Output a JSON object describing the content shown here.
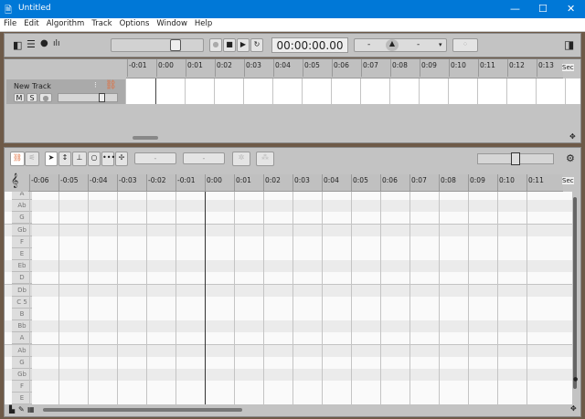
{
  "window": {
    "title": "Untitled",
    "minimize": "—",
    "maximize": "☐",
    "close": "✕"
  },
  "menu": [
    "File",
    "Edit",
    "Algorithm",
    "Track",
    "Options",
    "Window",
    "Help"
  ],
  "toolbar": {
    "time": "00:00:00.00",
    "pitch_left": "-",
    "pitch_right": "-"
  },
  "track": {
    "name": "New Track",
    "mute": "M",
    "solo": "S",
    "volume": 0.75
  },
  "top_ruler": {
    "ticks": [
      "-0:01",
      "0:00",
      "0:01",
      "0:02",
      "0:03",
      "0:04",
      "0:05",
      "0:06",
      "0:07",
      "0:08",
      "0:09",
      "0:10",
      "0:11",
      "0:12",
      "0:13"
    ],
    "unit": "Sec"
  },
  "editor": {
    "field1": "-",
    "field2": "-",
    "unit": "Sec",
    "ticks": [
      "-0:06",
      "-0:05",
      "-0:04",
      "-0:03",
      "-0:02",
      "-0:01",
      "0:00",
      "0:01",
      "0:02",
      "0:03",
      "0:04",
      "0:05",
      "0:06",
      "0:07",
      "0:08",
      "0:09",
      "0:10",
      "0:11"
    ],
    "keys": [
      {
        "n": "A",
        "b": false
      },
      {
        "n": "Ab",
        "b": true
      },
      {
        "n": "G",
        "b": false
      },
      {
        "n": "Gb",
        "b": true
      },
      {
        "n": "F",
        "b": false
      },
      {
        "n": "E",
        "b": false
      },
      {
        "n": "Eb",
        "b": true
      },
      {
        "n": "D",
        "b": false
      },
      {
        "n": "Db",
        "b": true
      },
      {
        "n": "C 5",
        "b": false
      },
      {
        "n": "B",
        "b": false
      },
      {
        "n": "Bb",
        "b": true
      },
      {
        "n": "A",
        "b": false
      },
      {
        "n": "Ab",
        "b": true
      },
      {
        "n": "G",
        "b": false
      },
      {
        "n": "Gb",
        "b": true
      },
      {
        "n": "F",
        "b": false
      },
      {
        "n": "E",
        "b": false
      }
    ]
  },
  "colors": {
    "titlebar": "#0078d7",
    "accent": "#e07040"
  }
}
